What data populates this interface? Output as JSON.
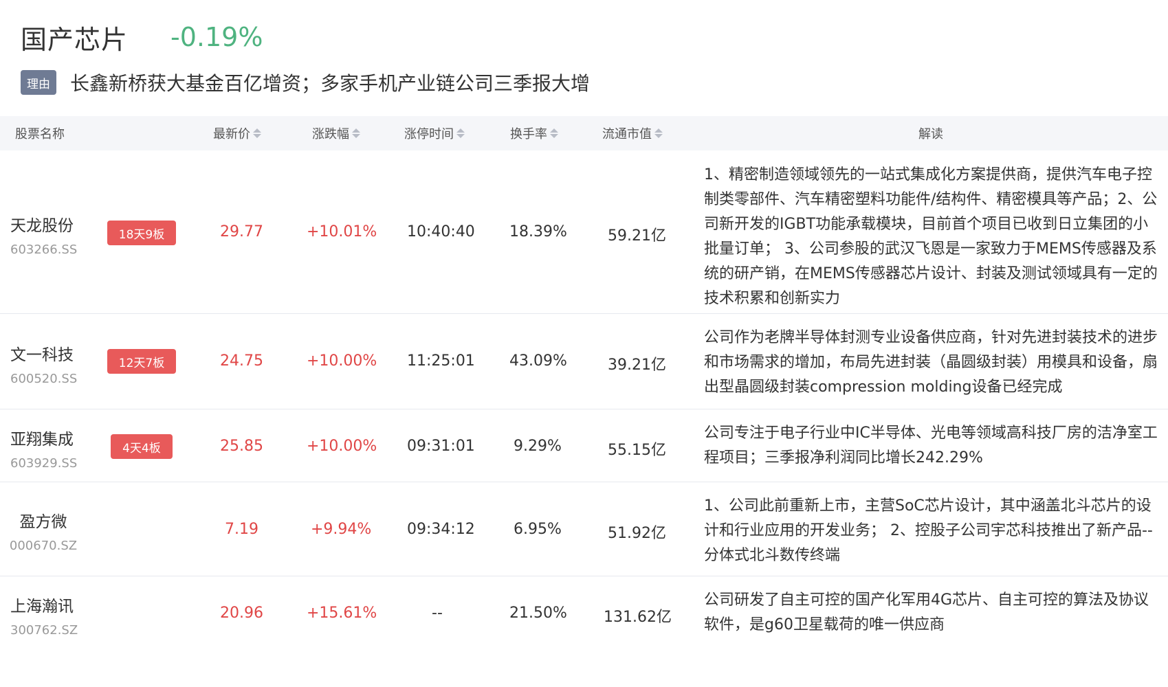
{
  "header": {
    "title": "国产芯片",
    "change": "-0.19%"
  },
  "reason": {
    "tag": "理由",
    "text": "长鑫新桥获大基金百亿增资；多家手机产业链公司三季报大增"
  },
  "columns": {
    "name": "股票名称",
    "price": "最新价",
    "change_pct": "涨跌幅",
    "limit_time": "涨停时间",
    "turnover": "换手率",
    "market_cap": "流通市值",
    "analysis": "解读"
  },
  "rows": [
    {
      "name": "天龙股份",
      "code": "603266.SS",
      "badge": "18天9板",
      "price": "29.77",
      "change_pct": "+10.01%",
      "limit_time": "10:40:40",
      "turnover": "18.39%",
      "market_cap": "59.21亿",
      "analysis": "1、精密制造领域领先的一站式集成化方案提供商，提供汽车电子控制类零部件、汽车精密塑料功能件/结构件、精密模具等产品；2、公司新开发的IGBT功能承载模块，目前首个项目已收到日立集团的小批量订单； 3、公司参股的武汉飞恩是一家致力于MEMS传感器及系统的研产销，在MEMS传感器芯片设计、封装及测试领域具有一定的技术积累和创新实力"
    },
    {
      "name": "文一科技",
      "code": "600520.SS",
      "badge": "12天7板",
      "price": "24.75",
      "change_pct": "+10.00%",
      "limit_time": "11:25:01",
      "turnover": "43.09%",
      "market_cap": "39.21亿",
      "analysis": "公司作为老牌半导体封测专业设备供应商，针对先进封装技术的进步和市场需求的增加，布局先进封装（晶圆级封装）用模具和设备，扇出型晶圆级封装compression molding设备已经完成"
    },
    {
      "name": "亚翔集成",
      "code": "603929.SS",
      "badge": "4天4板",
      "price": "25.85",
      "change_pct": "+10.00%",
      "limit_time": "09:31:01",
      "turnover": "9.29%",
      "market_cap": "55.15亿",
      "analysis": "公司专注于电子行业中IC半导体、光电等领域高科技厂房的洁净室工程项目；三季报净利润同比增长242.29%"
    },
    {
      "name": "盈方微",
      "code": "000670.SZ",
      "badge": "",
      "price": "7.19",
      "change_pct": "+9.94%",
      "limit_time": "09:34:12",
      "turnover": "6.95%",
      "market_cap": "51.92亿",
      "analysis": "1、公司此前重新上市，主营SoC芯片设计，其中涵盖北斗芯片的设计和行业应用的开发业务； 2、控股子公司宇芯科技推出了新产品--分体式北斗数传终端"
    },
    {
      "name": "上海瀚讯",
      "code": "300762.SZ",
      "badge": "",
      "price": "20.96",
      "change_pct": "+15.61%",
      "limit_time": "--",
      "turnover": "21.50%",
      "market_cap": "131.62亿",
      "analysis": "公司研发了自主可控的国产化军用4G芯片、自主可控的算法及协议软件，是g60卫星载荷的唯一供应商"
    }
  ]
}
